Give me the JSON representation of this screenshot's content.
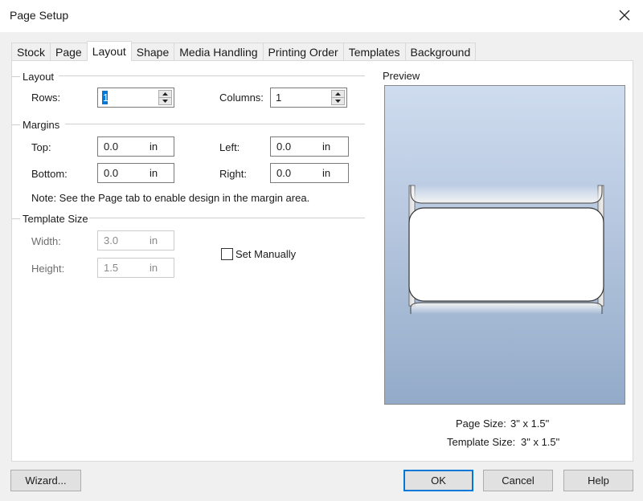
{
  "window": {
    "title": "Page Setup",
    "close_icon": "close-icon"
  },
  "tabs": [
    "Stock",
    "Page",
    "Layout",
    "Shape",
    "Media Handling",
    "Printing Order",
    "Templates",
    "Background"
  ],
  "active_tab": "Layout",
  "layout_group": {
    "title": "Layout",
    "rows_label": "Rows:",
    "rows_value": "1",
    "columns_label": "Columns:",
    "columns_value": "1"
  },
  "margins_group": {
    "title": "Margins",
    "top_label": "Top:",
    "top_value": "0.0",
    "left_label": "Left:",
    "left_value": "0.0",
    "bottom_label": "Bottom:",
    "bottom_value": "0.0",
    "right_label": "Right:",
    "right_value": "0.0",
    "unit": "in",
    "note": "Note: See the Page tab to enable design in the margin area."
  },
  "template_size_group": {
    "title": "Template Size",
    "width_label": "Width:",
    "width_value": "3.0",
    "height_label": "Height:",
    "height_value": "1.5",
    "unit": "in",
    "set_manually_label": "Set Manually",
    "set_manually_checked": false
  },
  "preview": {
    "title": "Preview",
    "page_size_label": "Page Size:",
    "page_size_value": "3\" x 1.5\"",
    "template_size_label": "Template Size:",
    "template_size_value": "3\" x 1.5\""
  },
  "buttons": {
    "wizard": "Wizard...",
    "ok": "OK",
    "cancel": "Cancel",
    "help": "Help"
  },
  "colors": {
    "accent": "#0078d7",
    "preview_top": "#cfdcef",
    "preview_bottom": "#93abc9"
  }
}
